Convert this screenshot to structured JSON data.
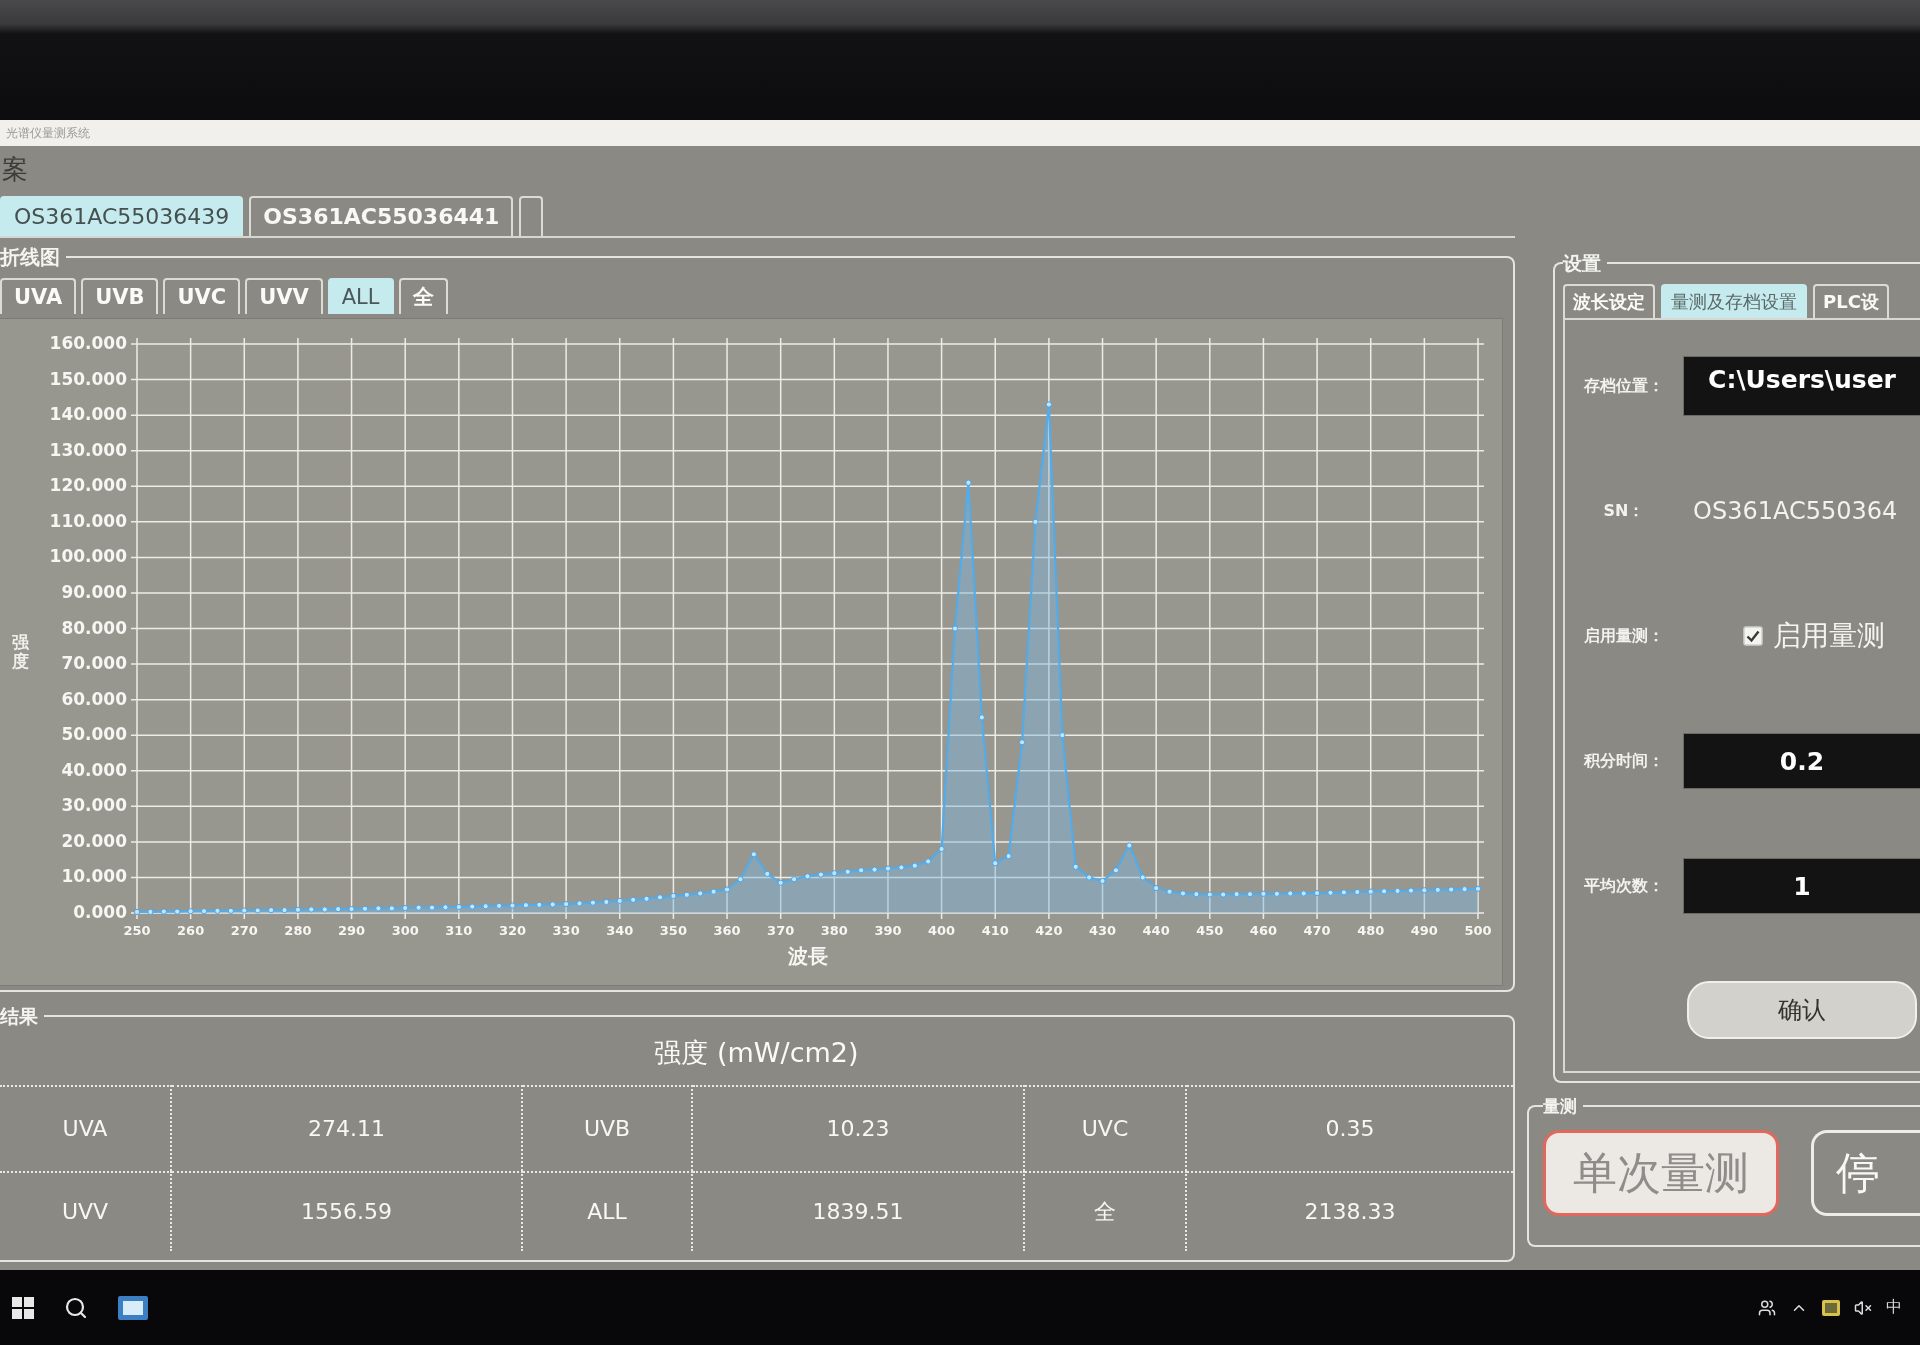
{
  "window": {
    "title": "光谱仪量测系统"
  },
  "archive": {
    "label": "案",
    "tabs": [
      {
        "label": "OS361AC55036439",
        "selected": true
      },
      {
        "label": "OS361AC55036441",
        "selected": false
      }
    ]
  },
  "line_chart": {
    "label": "折线图",
    "tabs": [
      {
        "label": "UVA",
        "selected": false
      },
      {
        "label": "UVB",
        "selected": false
      },
      {
        "label": "UVC",
        "selected": false
      },
      {
        "label": "UVV",
        "selected": false
      },
      {
        "label": "ALL",
        "selected": true
      },
      {
        "label": "全",
        "selected": false
      }
    ],
    "chart_data": {
      "type": "area",
      "xlabel": "波長",
      "ylabel": "强度",
      "grid": true,
      "x": [
        250,
        252.5,
        255,
        257.5,
        260,
        262.5,
        265,
        267.5,
        270,
        272.5,
        275,
        277.5,
        280,
        282.5,
        285,
        287.5,
        290,
        292.5,
        295,
        297.5,
        300,
        302.5,
        305,
        307.5,
        310,
        312.5,
        315,
        317.5,
        320,
        322.5,
        325,
        327.5,
        330,
        332.5,
        335,
        337.5,
        340,
        342.5,
        345,
        347.5,
        350,
        352.5,
        355,
        357.5,
        360,
        362.5,
        365,
        367.5,
        370,
        372.5,
        375,
        377.5,
        380,
        382.5,
        385,
        387.5,
        390,
        392.5,
        395,
        397.5,
        400,
        402.5,
        405,
        407.5,
        410,
        412.5,
        415,
        417.5,
        420,
        422.5,
        425,
        427.5,
        430,
        432.5,
        435,
        437.5,
        440,
        442.5,
        445,
        447.5,
        450,
        452.5,
        455,
        457.5,
        460,
        462.5,
        465,
        467.5,
        470,
        472.5,
        475,
        477.5,
        480,
        482.5,
        485,
        487.5,
        490,
        492.5,
        495,
        497.5,
        500
      ],
      "values": [
        0.3,
        0.3,
        0.4,
        0.4,
        0.5,
        0.5,
        0.6,
        0.6,
        0.7,
        0.7,
        0.8,
        0.8,
        0.9,
        1.0,
        1.0,
        1.1,
        1.1,
        1.2,
        1.3,
        1.3,
        1.4,
        1.5,
        1.5,
        1.6,
        1.7,
        1.8,
        1.9,
        2.0,
        2.1,
        2.2,
        2.3,
        2.4,
        2.5,
        2.7,
        2.9,
        3.1,
        3.4,
        3.7,
        4.0,
        4.4,
        4.8,
        5.1,
        5.5,
        6.0,
        6.6,
        9.5,
        16.5,
        11.0,
        8.5,
        9.5,
        10.3,
        10.8,
        11.2,
        11.6,
        12.0,
        12.2,
        12.5,
        12.8,
        13.3,
        14.5,
        18.0,
        80.0,
        121.0,
        55.0,
        14.0,
        16.0,
        48.0,
        110.0,
        143.0,
        50.0,
        13.0,
        10.0,
        9.0,
        12.0,
        19.0,
        10.0,
        7.0,
        6.0,
        5.5,
        5.3,
        5.2,
        5.2,
        5.3,
        5.3,
        5.4,
        5.4,
        5.5,
        5.5,
        5.6,
        5.7,
        5.8,
        5.9,
        6.0,
        6.1,
        6.2,
        6.3,
        6.4,
        6.5,
        6.6,
        6.7,
        6.8
      ],
      "xlim": [
        250,
        500
      ],
      "ylim": [
        0,
        160
      ],
      "xticks": [
        250,
        260,
        270,
        280,
        290,
        300,
        310,
        320,
        330,
        340,
        350,
        360,
        370,
        380,
        390,
        400,
        410,
        420,
        430,
        440,
        450,
        460,
        470,
        480,
        490,
        500
      ],
      "yticks": [
        {
          "value": 0,
          "label": "0.000"
        },
        {
          "value": 10,
          "label": "10.000"
        },
        {
          "value": 20,
          "label": "20.000"
        },
        {
          "value": 30,
          "label": "30.000"
        },
        {
          "value": 40,
          "label": "40.000"
        },
        {
          "value": 50,
          "label": "50.000"
        },
        {
          "value": 60,
          "label": "60.000"
        },
        {
          "value": 70,
          "label": "70.000"
        },
        {
          "value": 80,
          "label": "80.000"
        },
        {
          "value": 90,
          "label": "90.000"
        },
        {
          "value": 100,
          "label": "100.000"
        },
        {
          "value": 110,
          "label": "110.000"
        },
        {
          "value": 120,
          "label": "120.000"
        },
        {
          "value": 130,
          "label": "130.000"
        },
        {
          "value": 140,
          "label": "140.000"
        },
        {
          "value": 150,
          "label": "150.000"
        },
        {
          "value": 160,
          "label": "160.000"
        }
      ]
    }
  },
  "results": {
    "label": "结果",
    "header": "强度 (mW/cm2)",
    "rows": [
      [
        "UVA",
        "274.11",
        "UVB",
        "10.23",
        "UVC",
        "0.35"
      ],
      [
        "UVV",
        "1556.59",
        "ALL",
        "1839.51",
        "全",
        "2138.33"
      ]
    ]
  },
  "settings": {
    "label": "设置",
    "tabs": [
      {
        "label": "波长设定",
        "selected": false
      },
      {
        "label": "量测及存档设置",
        "selected": true
      },
      {
        "label": "PLC设",
        "selected": false
      }
    ],
    "fields": [
      {
        "kind": "path",
        "label": "存档位置：",
        "value": "C:\\Users\\user"
      },
      {
        "kind": "text",
        "label": "SN：",
        "value": "OS361AC550364"
      },
      {
        "kind": "checkbox",
        "label": "启用量测：",
        "text": "启用量测",
        "checked": true
      },
      {
        "kind": "input",
        "label": "积分时间：",
        "value": "0.2"
      },
      {
        "kind": "input",
        "label": "平均次数：",
        "value": "1"
      }
    ],
    "confirm_button": "确认"
  },
  "measure": {
    "label": "量测",
    "buttons": [
      {
        "label": "单次量测",
        "highlighted": true
      },
      {
        "label": "停",
        "highlighted": false
      }
    ]
  },
  "taskbar": {
    "input_method": "中"
  }
}
